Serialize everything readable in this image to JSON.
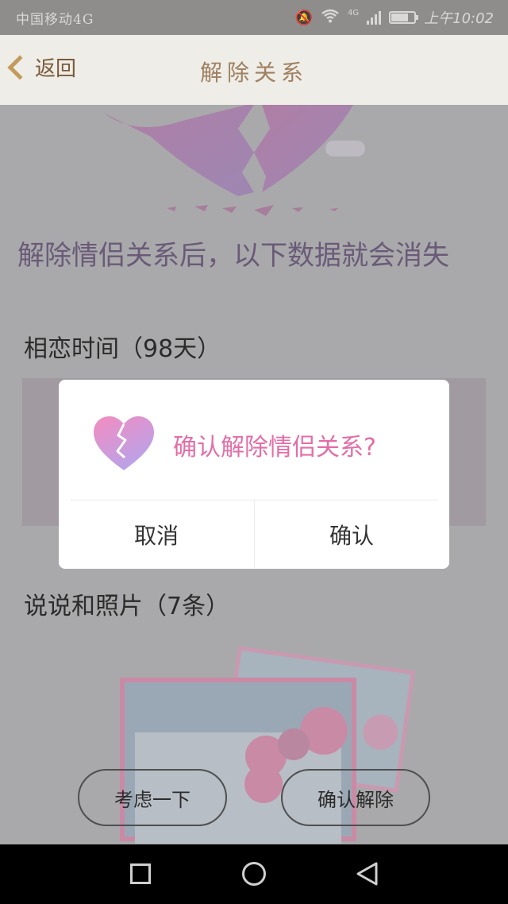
{
  "status_bar": {
    "carrier": "中国移动4G",
    "network": "4G",
    "time": "上午10:02"
  },
  "header": {
    "back_label": "返回",
    "title": "解除关系"
  },
  "content": {
    "headline": "解除情侣关系后，以下数据就会消失",
    "love_time_label": "相恋时间（98天）",
    "moments_label": "说说和照片（7条）"
  },
  "buttons": {
    "think_label": "考虑一下",
    "confirm_unbind_label": "确认解除"
  },
  "dialog": {
    "message": "确认解除情侣关系?",
    "cancel_label": "取消",
    "confirm_label": "确认"
  },
  "colors": {
    "dialog_accent": "#e36ea7",
    "header_bg": "#eeede7",
    "overlay_bg": "#a9a9ab"
  },
  "icons": {
    "back": "chevron-left-icon",
    "broken_heart": "broken-heart-icon",
    "mute": "mute-icon",
    "wifi": "wifi-icon",
    "signal": "signal-icon",
    "battery": "battery-icon",
    "nav_recent": "square-icon",
    "nav_home": "circle-icon",
    "nav_back": "triangle-back-icon"
  }
}
